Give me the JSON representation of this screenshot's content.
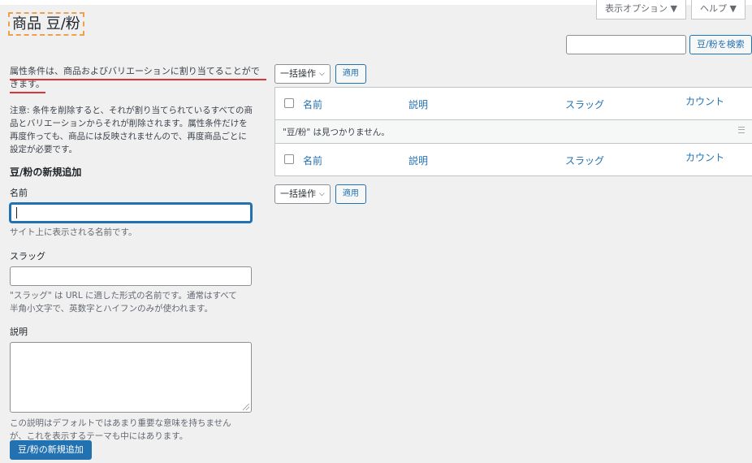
{
  "screen_meta": {
    "display_options": "表示オプション ▼",
    "help": "ヘルプ ▼"
  },
  "page_title": "商品 豆/粉",
  "search": {
    "value": "",
    "button": "豆/粉を検索"
  },
  "intro": {
    "line1": "属性条件は、商品およびバリエーションに割り当てることがで",
    "line2": "きます。"
  },
  "note": {
    "line1": "注意: 条件を削除すると、それが割り当てられているすべての商",
    "line2": "品とバリエーションからそれが削除されます。属性条件だけを",
    "line3": "再度作っても、商品には反映されませんので、再度商品ごとに",
    "line4": "設定が必要です。"
  },
  "form": {
    "heading": "豆/粉の新規追加",
    "name_label": "名前",
    "name_value": "",
    "name_help": "サイト上に表示される名前です。",
    "slug_label": "スラッグ",
    "slug_value": "",
    "slug_help_line1": "\"スラッグ\" は URL に適した形式の名前です。通常はすべて",
    "slug_help_line2": "半角小文字で、英数字とハイフンのみが使われます。",
    "desc_label": "説明",
    "desc_value": "",
    "desc_help_line1": "この説明はデフォルトではあまり重要な意味を持ちません",
    "desc_help_line2": "が、これを表示するテーマも中にはあります。",
    "submit": "豆/粉の新規追加"
  },
  "bulk": {
    "select_label": "一括操作",
    "apply": "適用"
  },
  "table": {
    "columns": [
      "名前",
      "説明",
      "スラッグ",
      "カウント"
    ],
    "empty_message": "\"豆/粉\" は見つかりません。"
  }
}
